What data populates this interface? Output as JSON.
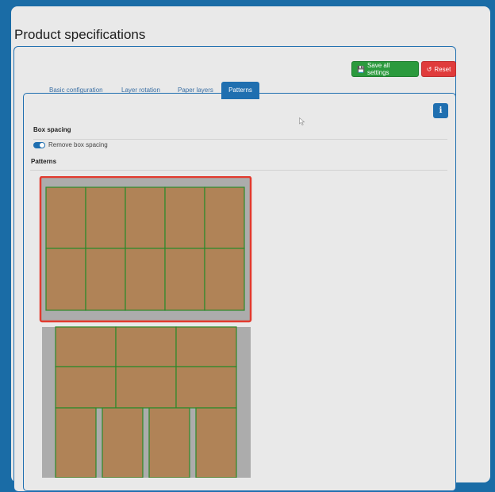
{
  "page": {
    "title": "Product specifications"
  },
  "toolbar": {
    "save_label": "Save all settings",
    "reset_label": "Reset",
    "save_color": "#2b9a3d",
    "reset_color": "#e03c3c",
    "save_icon": "floppy-disk-icon",
    "reset_icon": "undo-icon"
  },
  "tabs": [
    {
      "label": "Basic configuration",
      "active": false
    },
    {
      "label": "Layer rotation",
      "active": false
    },
    {
      "label": "Paper layers",
      "active": false
    },
    {
      "label": "Patterns",
      "active": true
    }
  ],
  "info_button": {
    "label": "i"
  },
  "box_spacing": {
    "heading": "Box spacing",
    "toggle_label": "Remove box spacing",
    "toggle_on": true
  },
  "patterns": {
    "heading": "Patterns",
    "items": [
      {
        "selected": true,
        "layout": "5 columns x 2 rows"
      },
      {
        "selected": false,
        "layout": "3 + 3 + 4 mixed"
      }
    ],
    "colors": {
      "box": "#b08357",
      "box_border": "#2a8a2a",
      "pallet": "#acacac",
      "selection": "#e23a2e"
    }
  }
}
